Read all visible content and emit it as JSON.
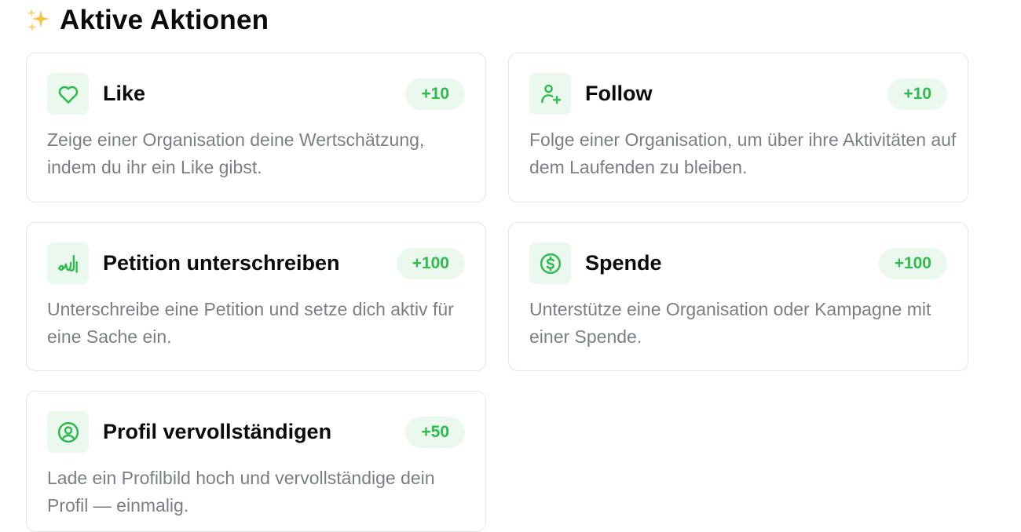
{
  "section": {
    "icon": "sparkles-icon",
    "title": "Aktive Aktionen"
  },
  "actions": [
    {
      "icon": "heart-icon",
      "title": "Like",
      "points": "+10",
      "description": "Zeige einer Organisation deine Wertschätzung, indem du ihr ein Like gibst."
    },
    {
      "icon": "user-plus-icon",
      "title": "Follow",
      "points": "+10",
      "description": "Folge einer Organisation, um über ihre Aktivitäten auf dem Laufenden zu bleiben."
    },
    {
      "icon": "signature-icon",
      "title": "Petition unterschreiben",
      "points": "+100",
      "description": "Unterschreibe eine Petition und setze dich aktiv für eine Sache ein."
    },
    {
      "icon": "dollar-circle-icon",
      "title": "Spende",
      "points": "+100",
      "description": "Unterstütze eine Organisation oder Kampagne mit einer Spende."
    },
    {
      "icon": "user-circle-icon",
      "title": "Profil vervollständigen",
      "points": "+50",
      "description": "Lade ein Profilbild hoch und vervollständige dein Profil — einmalig."
    }
  ],
  "colors": {
    "accent": "#2fbb4f",
    "accent_bg": "#eaf8ed",
    "card_border": "#e3e5e8",
    "muted_text": "#7a7f87",
    "sparkle": "#f5c542"
  }
}
